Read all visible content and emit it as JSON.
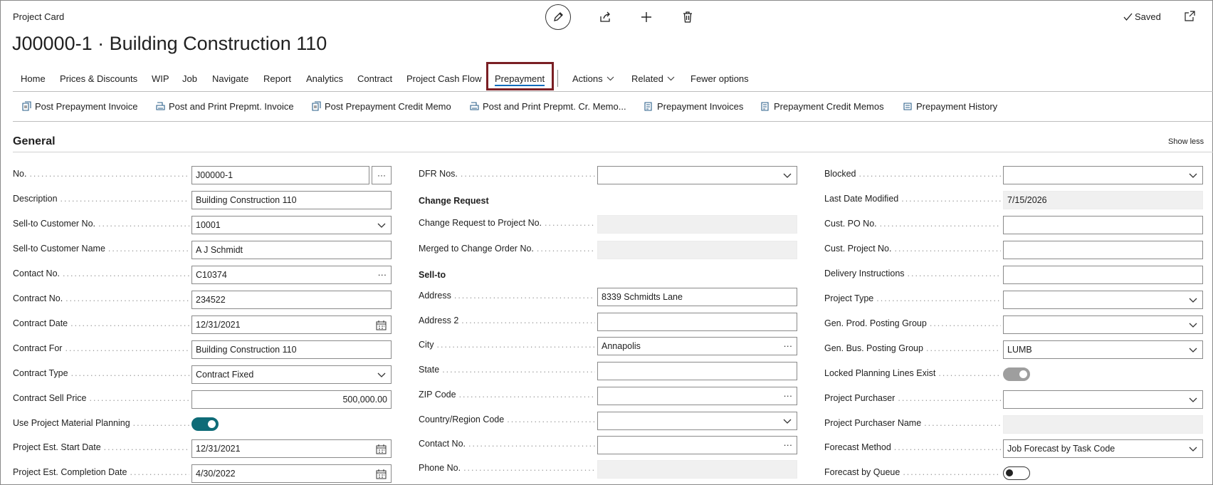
{
  "header": {
    "page_kind": "Project Card",
    "title": "J00000-1 · Building Construction 110",
    "saved_label": "Saved"
  },
  "menu": {
    "items": [
      "Home",
      "Prices & Discounts",
      "WIP",
      "Job",
      "Navigate",
      "Report",
      "Analytics",
      "Contract",
      "Project Cash Flow"
    ],
    "active": "Prepayment",
    "actions": "Actions",
    "related": "Related",
    "fewer": "Fewer options"
  },
  "action_bar": [
    "Post Prepayment Invoice",
    "Post and Print Prepmt. Invoice",
    "Post Prepayment Credit Memo",
    "Post and Print Prepmt. Cr. Memo...",
    "Prepayment Invoices",
    "Prepayment Credit Memos",
    "Prepayment History"
  ],
  "section": {
    "title": "General",
    "show_less": "Show less"
  },
  "col1": [
    {
      "label": "No.",
      "value": "J00000-1"
    },
    {
      "label": "Description",
      "value": "Building Construction 110"
    },
    {
      "label": "Sell-to Customer No.",
      "value": "10001"
    },
    {
      "label": "Sell-to Customer Name",
      "value": "A J Schmidt"
    },
    {
      "label": "Contact No.",
      "value": "C10374"
    },
    {
      "label": "Contract No.",
      "value": "234522"
    },
    {
      "label": "Contract Date",
      "value": "12/31/2021"
    },
    {
      "label": "Contract For",
      "value": "Building Construction 110"
    },
    {
      "label": "Contract Type",
      "value": "Contract Fixed"
    },
    {
      "label": "Contract Sell Price",
      "value": "500,000.00"
    },
    {
      "label": "Use Project Material Planning",
      "value": "on"
    },
    {
      "label": "Project Est. Start Date",
      "value": "12/31/2021"
    },
    {
      "label": "Project Est. Completion Date",
      "value": "4/30/2022"
    }
  ],
  "col2": [
    {
      "label": "DFR Nos.",
      "value": ""
    },
    {
      "label": "Change Request",
      "value": ""
    },
    {
      "label": "Change Request to Project No.",
      "value": ""
    },
    {
      "label": "Merged to Change Order No.",
      "value": ""
    },
    {
      "label": "Sell-to",
      "value": ""
    },
    {
      "label": "Address",
      "value": "8339 Schmidts Lane"
    },
    {
      "label": "Address 2",
      "value": ""
    },
    {
      "label": "City",
      "value": "Annapolis"
    },
    {
      "label": "State",
      "value": ""
    },
    {
      "label": "ZIP Code",
      "value": ""
    },
    {
      "label": "Country/Region Code",
      "value": ""
    },
    {
      "label": "Contact No.",
      "value": ""
    },
    {
      "label": "Phone No.",
      "value": ""
    }
  ],
  "col3": [
    {
      "label": "Blocked",
      "value": ""
    },
    {
      "label": "Last Date Modified",
      "value": "7/15/2026"
    },
    {
      "label": "Cust. PO No.",
      "value": ""
    },
    {
      "label": "Cust. Project No.",
      "value": ""
    },
    {
      "label": "Delivery Instructions",
      "value": ""
    },
    {
      "label": "Project Type",
      "value": ""
    },
    {
      "label": "Gen. Prod. Posting Group",
      "value": ""
    },
    {
      "label": "Gen. Bus. Posting Group",
      "value": "LUMB"
    },
    {
      "label": "Locked Planning Lines Exist",
      "value": "on"
    },
    {
      "label": "Project Purchaser",
      "value": ""
    },
    {
      "label": "Project Purchaser Name",
      "value": ""
    },
    {
      "label": "Forecast Method",
      "value": "Job Forecast by Task Code"
    },
    {
      "label": "Forecast by Queue",
      "value": "off"
    }
  ]
}
